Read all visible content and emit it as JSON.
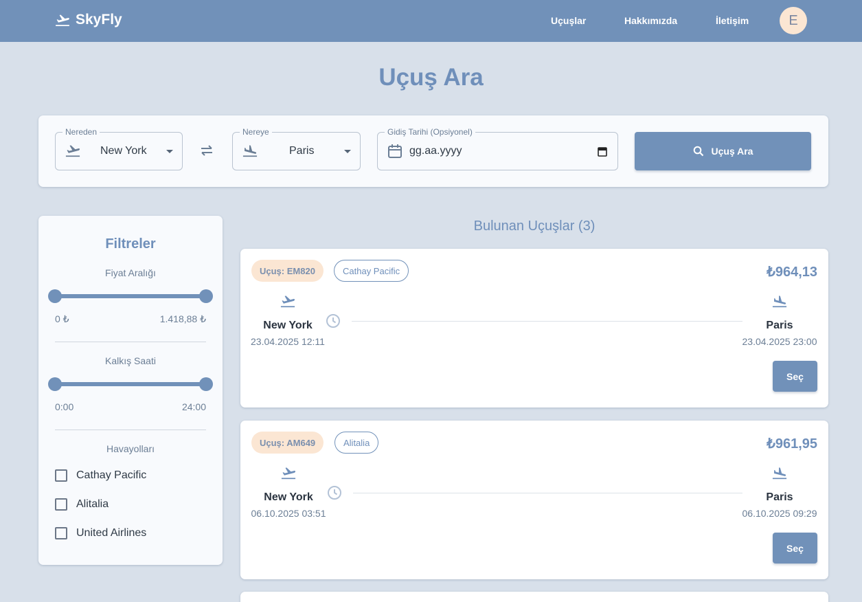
{
  "header": {
    "brand": "SkyFly",
    "nav": [
      "Uçuşlar",
      "Hakkımızda",
      "İletişim"
    ],
    "avatar_initial": "E"
  },
  "page_title": "Uçuş Ara",
  "search": {
    "from_label": "Nereden",
    "from_value": "New York",
    "to_label": "Nereye",
    "to_value": "Paris",
    "date_label": "Gidiş Tarihi (Opsiyonel)",
    "date_placeholder": "gg.aa.yyyy",
    "button_label": "Uçuş Ara"
  },
  "filters": {
    "title": "Filtreler",
    "price_label": "Fiyat Aralığı",
    "price_min": "0 ₺",
    "price_max": "1.418,88 ₺",
    "time_label": "Kalkış Saati",
    "time_min": "0:00",
    "time_max": "24:00",
    "airlines_label": "Havayolları",
    "airlines": [
      "Cathay Pacific",
      "Alitalia",
      "United Airlines"
    ]
  },
  "results": {
    "title": "Bulunan Uçuşlar (3)",
    "flights": [
      {
        "flight_no": "Uçuş: EM820",
        "airline": "Cathay Pacific",
        "price": "₺964,13",
        "from_city": "New York",
        "from_datetime": "23.04.2025 12:11",
        "to_city": "Paris",
        "to_datetime": "23.04.2025 23:00",
        "select_label": "Seç"
      },
      {
        "flight_no": "Uçuş: AM649",
        "airline": "Alitalia",
        "price": "₺961,95",
        "from_city": "New York",
        "from_datetime": "06.10.2025 03:51",
        "to_city": "Paris",
        "to_datetime": "06.10.2025 09:29",
        "select_label": "Seç"
      }
    ]
  },
  "colors": {
    "primary": "#7191b9",
    "background": "#d8e0ea",
    "chip": "#fbe6d3"
  }
}
